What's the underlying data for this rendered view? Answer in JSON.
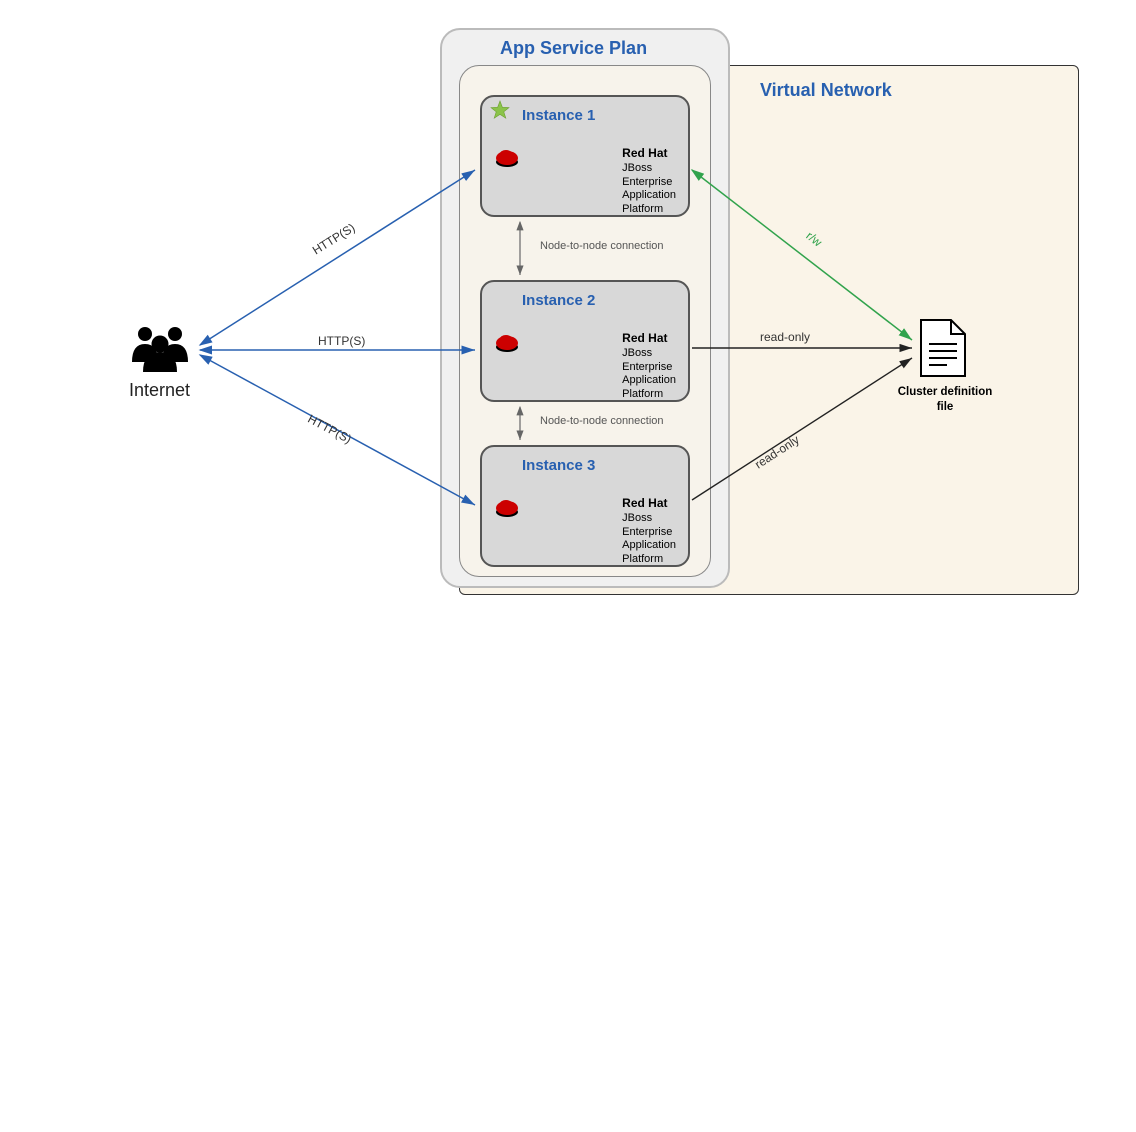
{
  "title_asp": "App Service Plan",
  "title_vnet": "Virtual Network",
  "internet": {
    "label": "Internet"
  },
  "instances": [
    {
      "title": "Instance 1",
      "vendor": "Red Hat",
      "product_l1": "JBoss Enterprise",
      "product_l2": "Application Platform",
      "leader": true
    },
    {
      "title": "Instance 2",
      "vendor": "Red Hat",
      "product_l1": "JBoss Enterprise",
      "product_l2": "Application Platform",
      "leader": false
    },
    {
      "title": "Instance 3",
      "vendor": "Red Hat",
      "product_l1": "JBoss Enterprise",
      "product_l2": "Application Platform",
      "leader": false
    }
  ],
  "edges": {
    "http1": "HTTP(S)",
    "http2": "HTTP(S)",
    "http3": "HTTP(S)",
    "node_conn": "Node-to-node connection",
    "rw": "r/w",
    "ro1": "read-only",
    "ro2": "read-only"
  },
  "file": {
    "label_l1": "Cluster definition",
    "label_l2": "file"
  },
  "colors": {
    "blue_arrow": "#2860b0",
    "green_arrow": "#31a34c",
    "black_arrow": "#222",
    "title_blue": "#2860b0",
    "star_green": "#8bc34a",
    "redhat_red": "#cc0000"
  }
}
